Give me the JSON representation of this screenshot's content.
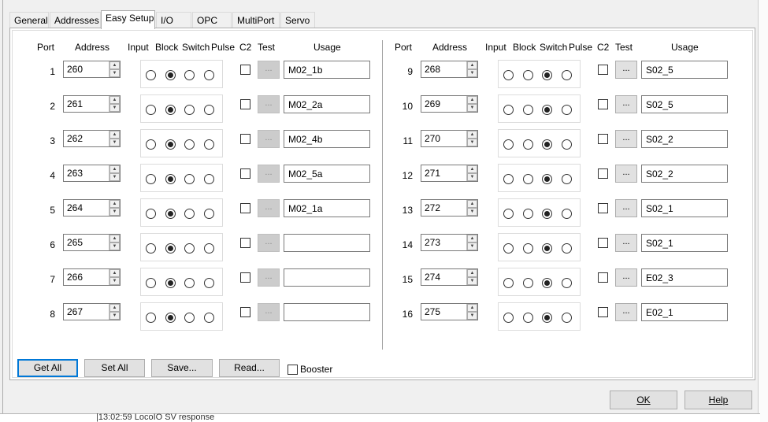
{
  "tabs": [
    {
      "label": "General",
      "active": false
    },
    {
      "label": "Addresses",
      "active": false
    },
    {
      "label": "Easy Setup",
      "active": true
    },
    {
      "label": "I/O",
      "active": false
    },
    {
      "label": "OPC",
      "active": false
    },
    {
      "label": "MultiPort",
      "active": false
    },
    {
      "label": "Servo",
      "active": false
    }
  ],
  "headers": {
    "port": "Port",
    "address": "Address",
    "input": "Input",
    "block": "Block",
    "switch": "Switch",
    "pulse": "Pulse",
    "c2": "C2",
    "test": "Test",
    "usage": "Usage"
  },
  "ports_left": [
    {
      "port": "1",
      "address": "260",
      "mode": 1,
      "c2": false,
      "test_label": "...",
      "test_enabled": false,
      "usage": "M02_1b"
    },
    {
      "port": "2",
      "address": "261",
      "mode": 1,
      "c2": false,
      "test_label": "...",
      "test_enabled": false,
      "usage": "M02_2a"
    },
    {
      "port": "3",
      "address": "262",
      "mode": 1,
      "c2": false,
      "test_label": "...",
      "test_enabled": false,
      "usage": "M02_4b"
    },
    {
      "port": "4",
      "address": "263",
      "mode": 1,
      "c2": false,
      "test_label": "...",
      "test_enabled": false,
      "usage": "M02_5a"
    },
    {
      "port": "5",
      "address": "264",
      "mode": 1,
      "c2": false,
      "test_label": "...",
      "test_enabled": false,
      "usage": "M02_1a"
    },
    {
      "port": "6",
      "address": "265",
      "mode": 1,
      "c2": false,
      "test_label": "...",
      "test_enabled": false,
      "usage": ""
    },
    {
      "port": "7",
      "address": "266",
      "mode": 1,
      "c2": false,
      "test_label": "...",
      "test_enabled": false,
      "usage": ""
    },
    {
      "port": "8",
      "address": "267",
      "mode": 1,
      "c2": false,
      "test_label": "...",
      "test_enabled": false,
      "usage": ""
    }
  ],
  "ports_right": [
    {
      "port": "9",
      "address": "268",
      "mode": 2,
      "c2": false,
      "test_label": "...",
      "test_enabled": true,
      "usage": "S02_5"
    },
    {
      "port": "10",
      "address": "269",
      "mode": 2,
      "c2": false,
      "test_label": "...",
      "test_enabled": true,
      "usage": "S02_5"
    },
    {
      "port": "11",
      "address": "270",
      "mode": 2,
      "c2": false,
      "test_label": "...",
      "test_enabled": true,
      "usage": "S02_2"
    },
    {
      "port": "12",
      "address": "271",
      "mode": 2,
      "c2": false,
      "test_label": "...",
      "test_enabled": true,
      "usage": "S02_2"
    },
    {
      "port": "13",
      "address": "272",
      "mode": 2,
      "c2": false,
      "test_label": "...",
      "test_enabled": true,
      "usage": "S02_1"
    },
    {
      "port": "14",
      "address": "273",
      "mode": 2,
      "c2": false,
      "test_label": "...",
      "test_enabled": true,
      "usage": "S02_1"
    },
    {
      "port": "15",
      "address": "274",
      "mode": 2,
      "c2": false,
      "test_label": "...",
      "test_enabled": true,
      "usage": "E02_3"
    },
    {
      "port": "16",
      "address": "275",
      "mode": 2,
      "c2": false,
      "test_label": "...",
      "test_enabled": true,
      "usage": "E02_1"
    }
  ],
  "actions": {
    "get_all": "Get All",
    "set_all": "Set All",
    "save": "Save...",
    "read": "Read...",
    "booster_label": "Booster",
    "booster_checked": false
  },
  "footer": {
    "ok": "OK",
    "help": "Help"
  },
  "background_log": "|13:02:59 LocoIO SV response"
}
